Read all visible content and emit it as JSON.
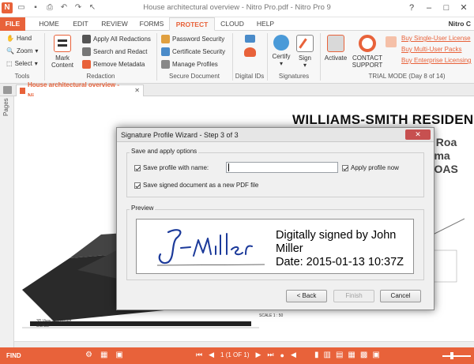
{
  "app": {
    "window_title": "House architectural overview - Nitro Pro.pdf - Nitro Pro 9",
    "user": "Nitro C"
  },
  "tabs": [
    "FILE",
    "HOME",
    "EDIT",
    "REVIEW",
    "FORMS",
    "PROTECT",
    "CLOUD",
    "HELP"
  ],
  "active_tab": "PROTECT",
  "ribbon": {
    "tools": {
      "items": [
        "Hand",
        "Zoom",
        "Select"
      ],
      "label": "Tools"
    },
    "redaction": {
      "mark_content": "Mark\nContent",
      "items": [
        "Apply All Redactions",
        "Search and Redact",
        "Remove Metadata"
      ],
      "label": "Redaction"
    },
    "secure": {
      "items": [
        "Password Security",
        "Certificate Security",
        "Manage Profiles"
      ],
      "label": "Secure Document"
    },
    "digital_ids": {
      "label": "Digital IDs"
    },
    "signatures": {
      "certify": "Certify",
      "sign": "Sign",
      "label": "Signatures"
    },
    "activate": "Activate",
    "contact": "CONTACT\nSUPPORT",
    "trial_links": [
      "Buy Single-User License",
      "Buy Multi-User Packs",
      "Buy Enterprise Licensing"
    ],
    "trial_label": "TRIAL MODE (Day 8 of 14)"
  },
  "document": {
    "tab_label": "House architectural overview - Ni...",
    "pages_label": "Pages",
    "heading": "WILLIAMS-SMITH RESIDENCE",
    "address_lines": [
      "etta Roa",
      "Rauma",
      "TI COAS"
    ],
    "caption1": "3D View - Proposed",
    "caption2": "SCALE",
    "scale_label": "SCALE 1 : 50"
  },
  "dialog": {
    "title": "Signature Profile Wizard - Step 3 of 3",
    "close": "✕",
    "save_group": "Save and apply options",
    "save_profile_label": "Save profile with name:",
    "profile_name": "",
    "apply_profile_label": "Apply profile now",
    "save_signed_label": "Save signed document as a new PDF file",
    "preview_group": "Preview",
    "signature_lines": [
      "Digitally signed by John",
      "Miller",
      "Date: 2015-01-13 10:37Z"
    ],
    "back": "< Back",
    "finish": "Finish",
    "cancel": "Cancel"
  },
  "status": {
    "find": "FIND",
    "page": "1 (1 OF 1)"
  }
}
